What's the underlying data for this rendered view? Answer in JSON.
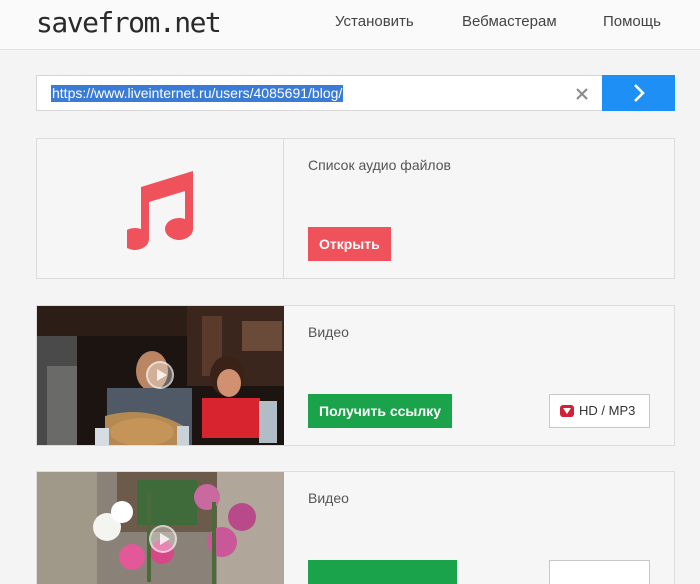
{
  "header": {
    "logo": "savefrom.net",
    "nav": [
      "Установить",
      "Вебмастерам",
      "Помощь"
    ]
  },
  "search": {
    "url": "https://www.liveinternet.ru/users/4085691/blog/"
  },
  "results": [
    {
      "type": "audio",
      "title": "Список аудио файлов",
      "button": "Открыть",
      "icon": "music-note-icon"
    },
    {
      "type": "video",
      "title": "Видео",
      "button": "Получить ссылку",
      "extra": "HD / MP3",
      "icon": "play-icon"
    },
    {
      "type": "video",
      "title": "Видео",
      "icon": "play-icon"
    }
  ],
  "colors": {
    "accent_blue": "#1e90f5",
    "open_red": "#f0525c",
    "link_green": "#1aa34a",
    "download_red": "#d0213a"
  }
}
